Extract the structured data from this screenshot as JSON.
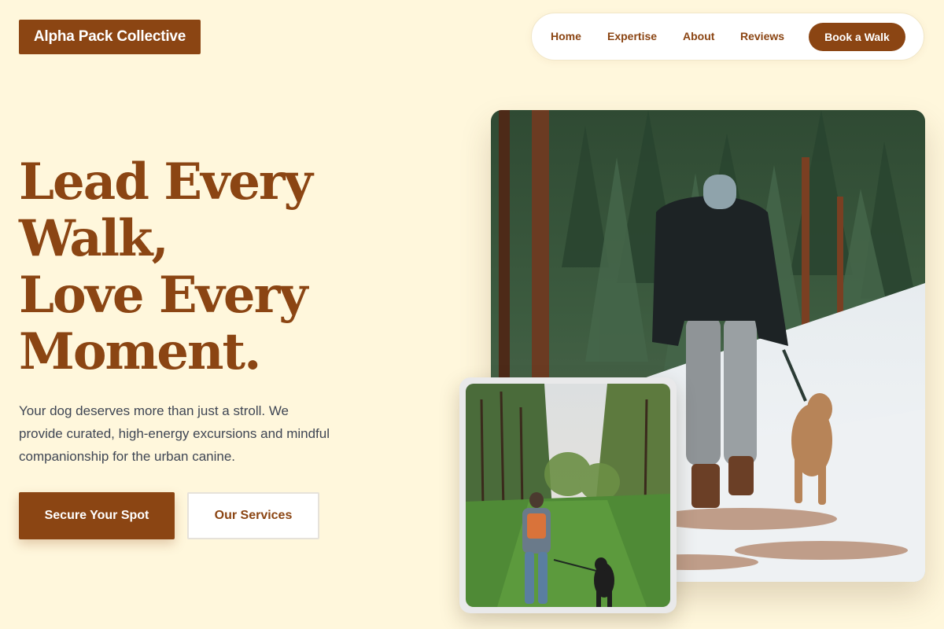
{
  "brand": {
    "name": "Alpha Pack Collective"
  },
  "nav": {
    "links": [
      "Home",
      "Expertise",
      "About",
      "Reviews"
    ],
    "cta": "Book a Walk"
  },
  "hero": {
    "headline_lines": [
      "Lead Every",
      "Walk,",
      "Love Every",
      "Moment."
    ],
    "lede": "Your dog deserves more than just a stroll. We provide curated, high-energy excursions and mindful companionship for the urban canine.",
    "primary_cta": "Secure Your Spot",
    "secondary_cta": "Our Services"
  },
  "images": {
    "main": "person-walking-dog-in-snowy-forest-photo",
    "small": "person-with-backpack-walking-dog-on-grassy-path-photo"
  },
  "colors": {
    "background": "#fff7dc",
    "accent": "#8b4513",
    "body_text": "#3f4654"
  }
}
